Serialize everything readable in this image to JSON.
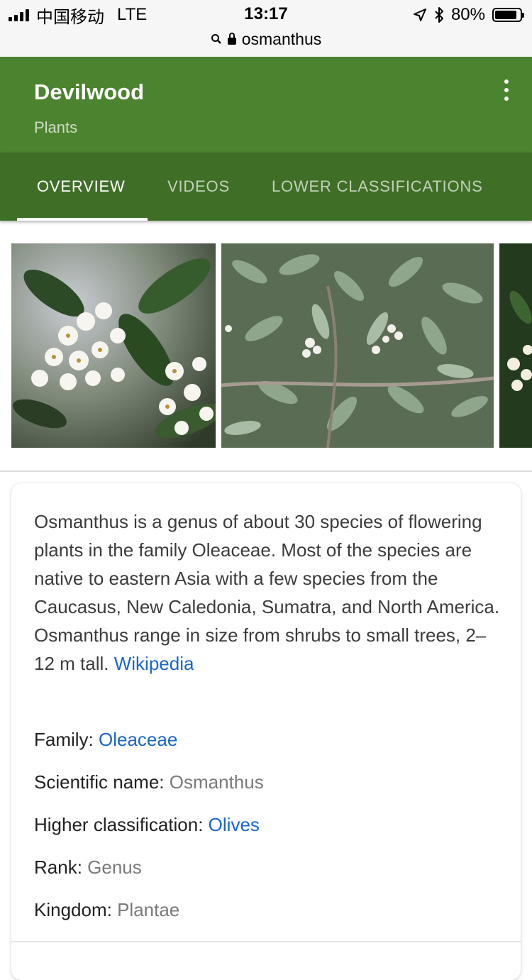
{
  "status_bar": {
    "carrier": "中国移动",
    "network": "LTE",
    "time": "13:17",
    "battery": "80%",
    "url": "osmanthus"
  },
  "header": {
    "title": "Devilwood",
    "subtitle": "Plants"
  },
  "tabs": [
    {
      "label": "OVERVIEW",
      "active": true
    },
    {
      "label": "VIDEOS",
      "active": false
    },
    {
      "label": "LOWER CLASSIFICATIONS",
      "active": false
    }
  ],
  "description": {
    "text": "Osmanthus is a genus of about 30 species of flowering plants in the family Oleaceae. Most of the species are native to eastern Asia with a few species from the Caucasus, New Caledonia, Sumatra, and North America. Osmanthus range in size from shrubs to small trees, 2–12 m tall.",
    "source_link": "Wikipedia"
  },
  "facts": [
    {
      "label": "Family:",
      "value": "Oleaceae",
      "link": true
    },
    {
      "label": "Scientific name:",
      "value": "Osmanthus",
      "link": false
    },
    {
      "label": "Higher classification:",
      "value": "Olives",
      "link": true
    },
    {
      "label": "Rank:",
      "value": "Genus",
      "link": false
    },
    {
      "label": "Kingdom:",
      "value": "Plantae",
      "link": false
    }
  ],
  "colors": {
    "header": "#4c832e",
    "tabs": "#3f6e26",
    "link": "#1a66c8"
  }
}
